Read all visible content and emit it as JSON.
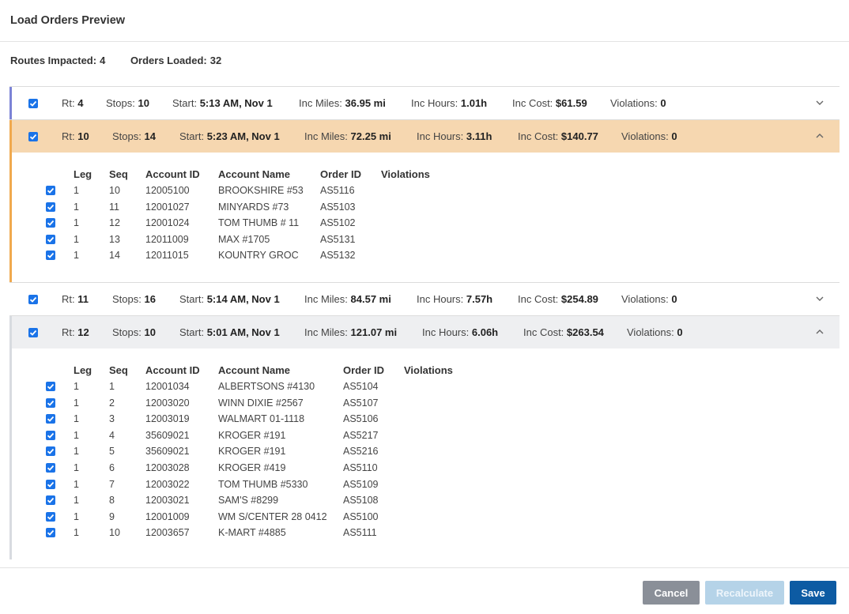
{
  "header": {
    "title": "Load Orders Preview"
  },
  "summary": {
    "routes_impacted_label": "Routes Impacted:",
    "routes_impacted_value": "4",
    "orders_loaded_label": "Orders Loaded:",
    "orders_loaded_value": "32"
  },
  "labels": {
    "rt": "Rt:",
    "stops": "Stops:",
    "start": "Start:",
    "miles": "Inc Miles:",
    "hours": "Inc Hours:",
    "cost": "Inc Cost:",
    "violations": "Violations:"
  },
  "columns": [
    "Leg",
    "Seq",
    "Account ID",
    "Account Name",
    "Order ID",
    "Violations"
  ],
  "routes": [
    {
      "rt": "4",
      "stops": "10",
      "start": "5:13 AM, Nov 1",
      "miles": "36.95 mi",
      "hours": "1.01h",
      "cost": "$61.59",
      "violations": "0",
      "expanded": false,
      "accent": "#7b83d6",
      "bg": "#ffffff",
      "orders": []
    },
    {
      "rt": "10",
      "stops": "14",
      "start": "5:23 AM, Nov 1",
      "miles": "72.25 mi",
      "hours": "3.11h",
      "cost": "$140.77",
      "violations": "0",
      "expanded": true,
      "accent": "#f0a94e",
      "bg": "#f6d7b0",
      "orders": [
        {
          "leg": "1",
          "seq": "10",
          "account_id": "12005100",
          "account_name": "BROOKSHIRE #53",
          "order_id": "AS5116"
        },
        {
          "leg": "1",
          "seq": "11",
          "account_id": "12001027",
          "account_name": "MINYARDS #73",
          "order_id": "AS5103"
        },
        {
          "leg": "1",
          "seq": "12",
          "account_id": "12001024",
          "account_name": "TOM THUMB # 11",
          "order_id": "AS5102"
        },
        {
          "leg": "1",
          "seq": "13",
          "account_id": "12011009",
          "account_name": "MAX #1705",
          "order_id": "AS5131"
        },
        {
          "leg": "1",
          "seq": "14",
          "account_id": "12011015",
          "account_name": "KOUNTRY GROC",
          "order_id": "AS5132"
        }
      ]
    },
    {
      "rt": "11",
      "stops": "16",
      "start": "5:14 AM, Nov 1",
      "miles": "84.57 mi",
      "hours": "7.57h",
      "cost": "$254.89",
      "violations": "0",
      "expanded": false,
      "accent": "#ffffff",
      "bg": "#ffffff",
      "orders": []
    },
    {
      "rt": "12",
      "stops": "10",
      "start": "5:01 AM, Nov 1",
      "miles": "121.07 mi",
      "hours": "6.06h",
      "cost": "$263.54",
      "violations": "0",
      "expanded": true,
      "accent": "#d8dbe0",
      "bg": "#eeeff1",
      "orders": [
        {
          "leg": "1",
          "seq": "1",
          "account_id": "12001034",
          "account_name": "ALBERTSONS #4130",
          "order_id": "AS5104"
        },
        {
          "leg": "1",
          "seq": "2",
          "account_id": "12003020",
          "account_name": "WINN DIXIE #2567",
          "order_id": "AS5107"
        },
        {
          "leg": "1",
          "seq": "3",
          "account_id": "12003019",
          "account_name": "WALMART 01-1118",
          "order_id": "AS5106"
        },
        {
          "leg": "1",
          "seq": "4",
          "account_id": "35609021",
          "account_name": "KROGER #191",
          "order_id": "AS5217"
        },
        {
          "leg": "1",
          "seq": "5",
          "account_id": "35609021",
          "account_name": "KROGER #191",
          "order_id": "AS5216"
        },
        {
          "leg": "1",
          "seq": "6",
          "account_id": "12003028",
          "account_name": "KROGER #419",
          "order_id": "AS5110"
        },
        {
          "leg": "1",
          "seq": "7",
          "account_id": "12003022",
          "account_name": "TOM THUMB #5330",
          "order_id": "AS5109"
        },
        {
          "leg": "1",
          "seq": "8",
          "account_id": "12003021",
          "account_name": "SAM'S #8299",
          "order_id": "AS5108"
        },
        {
          "leg": "1",
          "seq": "9",
          "account_id": "12001009",
          "account_name": "WM S/CENTER 28 0412",
          "order_id": "AS5100"
        },
        {
          "leg": "1",
          "seq": "10",
          "account_id": "12003657",
          "account_name": "K-MART #4885",
          "order_id": "AS5111"
        }
      ]
    }
  ],
  "footer": {
    "cancel_label": "Cancel",
    "recalculate_label": "Recalculate",
    "save_label": "Save"
  }
}
